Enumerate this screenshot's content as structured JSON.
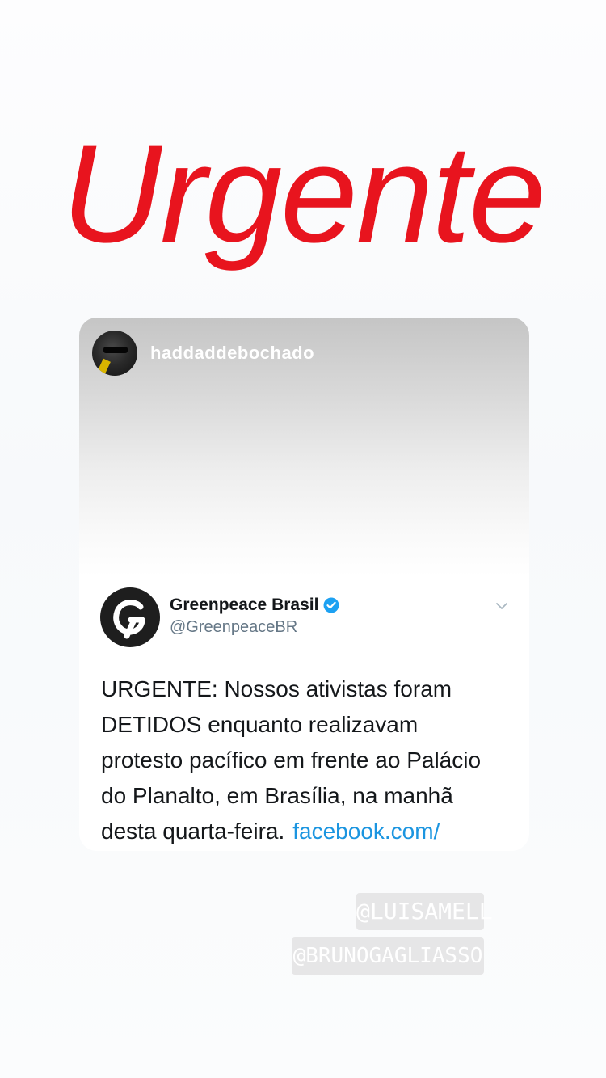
{
  "headline": "Urgente",
  "post": {
    "username": "haddaddebochado",
    "tweet": {
      "account_name": "Greenpeace Brasil",
      "handle": "@GreenpeaceBR",
      "verified": true,
      "text_lines": [
        "URGENTE: Nossos ativistas foram",
        "DETIDOS enquanto realizavam",
        "protesto pacífico em frente ao Palácio",
        "do Planalto, em Brasília, na manhã",
        "desta quarta-feira."
      ],
      "link": "facebook.com/"
    }
  },
  "mentions": [
    "@LUISAMELL",
    "@BRUNOGAGLIASSO"
  ],
  "colors": {
    "headline": "#e8141e",
    "link": "#1b95e0",
    "verified": "#1da1f2",
    "mention_bg": "#e6e6e7"
  },
  "icons": {
    "tweet_menu": "chevron-down-icon",
    "verified": "verified-badge-icon",
    "brand": "greenpeace-logo"
  }
}
